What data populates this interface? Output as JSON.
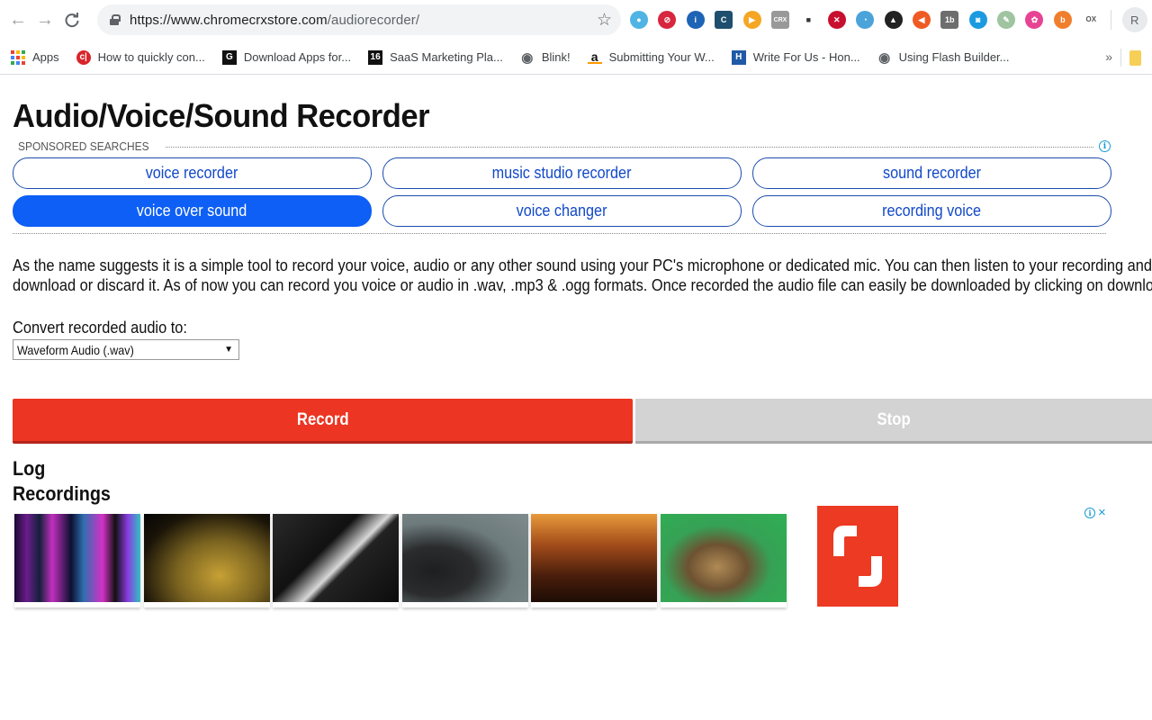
{
  "browser": {
    "url_host": "https://www.chromecrxstore.com",
    "url_path": "/audiorecorder/",
    "nav": {
      "back": "←",
      "forward": "→",
      "reload": "C"
    },
    "extensions": [
      {
        "name": "extension-webcam-icon",
        "color": "#4fb3e3",
        "glyph": "●"
      },
      {
        "name": "extension-red-circle-icon",
        "color": "#d7263d",
        "glyph": "⊘"
      },
      {
        "name": "extension-blue-info-icon",
        "color": "#1e63b5",
        "glyph": "i"
      },
      {
        "name": "extension-pacman-icon",
        "color": "#1e4f6e",
        "glyph": "C"
      },
      {
        "name": "extension-play-icon",
        "color": "#f5a623",
        "glyph": "▶"
      },
      {
        "name": "extension-crx-icon",
        "color": "#999999",
        "glyph": "CRX"
      },
      {
        "name": "extension-camera-icon",
        "color": "#333333",
        "glyph": "■"
      },
      {
        "name": "extension-no-flash-icon",
        "color": "#c8102e",
        "glyph": "✕"
      },
      {
        "name": "extension-satellite-icon",
        "color": "#4aa3d9",
        "glyph": "◔"
      },
      {
        "name": "extension-ninja-icon",
        "color": "#222222",
        "glyph": "▲"
      },
      {
        "name": "extension-arrow-icon",
        "color": "#ef5a24",
        "glyph": "◀"
      },
      {
        "name": "extension-1b-icon",
        "color": "#6d6d6d",
        "glyph": "1b"
      },
      {
        "name": "extension-lock-icon",
        "color": "#1c9ae0",
        "glyph": "◙"
      },
      {
        "name": "extension-paint-icon",
        "color": "#9ec4a0",
        "glyph": "✎"
      },
      {
        "name": "extension-flower-icon",
        "color": "#e84393",
        "glyph": "✿"
      },
      {
        "name": "extension-b-icon",
        "color": "#f07f2d",
        "glyph": "b"
      },
      {
        "name": "extension-oxxo-icon",
        "color": "#ffffff",
        "glyph": "OX"
      }
    ],
    "profile_initial": "R",
    "bookmarks": [
      {
        "label": "Apps",
        "icon": "apps-grid-icon"
      },
      {
        "label": "How to quickly con...",
        "icon": "cj-icon",
        "color": "#d9252a",
        "glyph": "c|"
      },
      {
        "label": "Download Apps for...",
        "icon": "g-icon",
        "color": "#111111",
        "glyph": "G"
      },
      {
        "label": "SaaS Marketing Pla...",
        "icon": "16-icon",
        "color": "#111111",
        "glyph": "16"
      },
      {
        "label": "Blink!",
        "icon": "globe-icon",
        "color": "#5f6368",
        "glyph": "◉"
      },
      {
        "label": "Submitting Your W...",
        "icon": "amazon-icon",
        "color": "#ffffff",
        "glyph": "a"
      },
      {
        "label": "Write For Us - Hon...",
        "icon": "h-icon",
        "color": "#1f5aa6",
        "glyph": "H"
      },
      {
        "label": "Using Flash Builder...",
        "icon": "globe-icon",
        "color": "#5f6368",
        "glyph": "◉"
      }
    ],
    "bookmarks_more": "»"
  },
  "page": {
    "title": "Audio/Voice/Sound Recorder",
    "sponsored_label": "SPONSORED SEARCHES",
    "searches": [
      {
        "label": "voice recorder",
        "active": false
      },
      {
        "label": "music studio recorder",
        "active": false
      },
      {
        "label": "sound recorder",
        "active": false
      },
      {
        "label": "voice over sound",
        "active": true
      },
      {
        "label": "voice changer",
        "active": false
      },
      {
        "label": "recording voice",
        "active": false
      }
    ],
    "description_line1": "As the name suggests it is a simple tool to record your voice, audio or any other sound using your PC's microphone or dedicated mic. You can then listen to your recording and d",
    "description_line2": "download or discard it. As of now you can record you voice or audio in .wav, .mp3 & .ogg formats. Once recorded the audio file can easily be downloaded by clicking on downloa",
    "convert_label": "Convert recorded audio to:",
    "format_selected": "Waveform Audio (.wav)",
    "record_label": "Record",
    "stop_label": "Stop",
    "log_heading": "Log",
    "recordings_heading": "Recordings",
    "thumbnails": [
      {
        "name": "equalizer-thumbnail"
      },
      {
        "name": "gold-glitter-thumbnail"
      },
      {
        "name": "cat-piano-thumbnail"
      },
      {
        "name": "black-panther-thumbnail"
      },
      {
        "name": "concert-crowd-thumbnail"
      },
      {
        "name": "roaring-lion-thumbnail"
      }
    ],
    "ad": {
      "info": "i",
      "close": "×"
    }
  },
  "colors": {
    "record": "#ec3522",
    "stop": "#d3d3d3",
    "pill_border": "#1c4cad",
    "pill_active": "#0d5ff5",
    "ad_logo": "#ec3a23",
    "info_blue": "#1a9ad6"
  }
}
